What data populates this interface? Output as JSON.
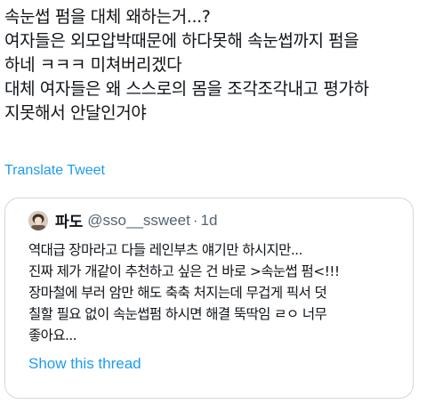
{
  "tweet": {
    "lines": [
      "속눈썹 펌을 대체 왜하는거...?",
      "여자들은 외모압박때문에 하다못해 속눈썹까지 펌을",
      "하네 ㅋㅋㅋ 미쳐버리겠다",
      "대체 여자들은 왜 스스로의 몸을 조각조각내고 평가하",
      "지못해서 안달인거야"
    ],
    "translate_label": "Translate Tweet"
  },
  "quote": {
    "author_name": "파도",
    "author_handle": "@sso__ssweet",
    "separator": "·",
    "time_ago": "1d",
    "lines": [
      "역대급 장마라고 다들 레인부츠 얘기만 하시지만...",
      "진짜 제가 개같이 추천하고 싶은 건 바로 >속눈썹 펌<!!!",
      "장마철에 부러 암만 해도 축축 처지는데 무겁게 픽서 덧",
      "칠할 필요 없이 속눈썹펌 하시면 해결 뚝딱임 ㄹㅇ 너무",
      "좋아요..."
    ],
    "show_thread_label": "Show this thread"
  },
  "colors": {
    "text": "#0f1419",
    "link": "#1d9bf0",
    "secondary_text": "#536471",
    "border": "#cfd9de",
    "background": "#ffffff"
  }
}
